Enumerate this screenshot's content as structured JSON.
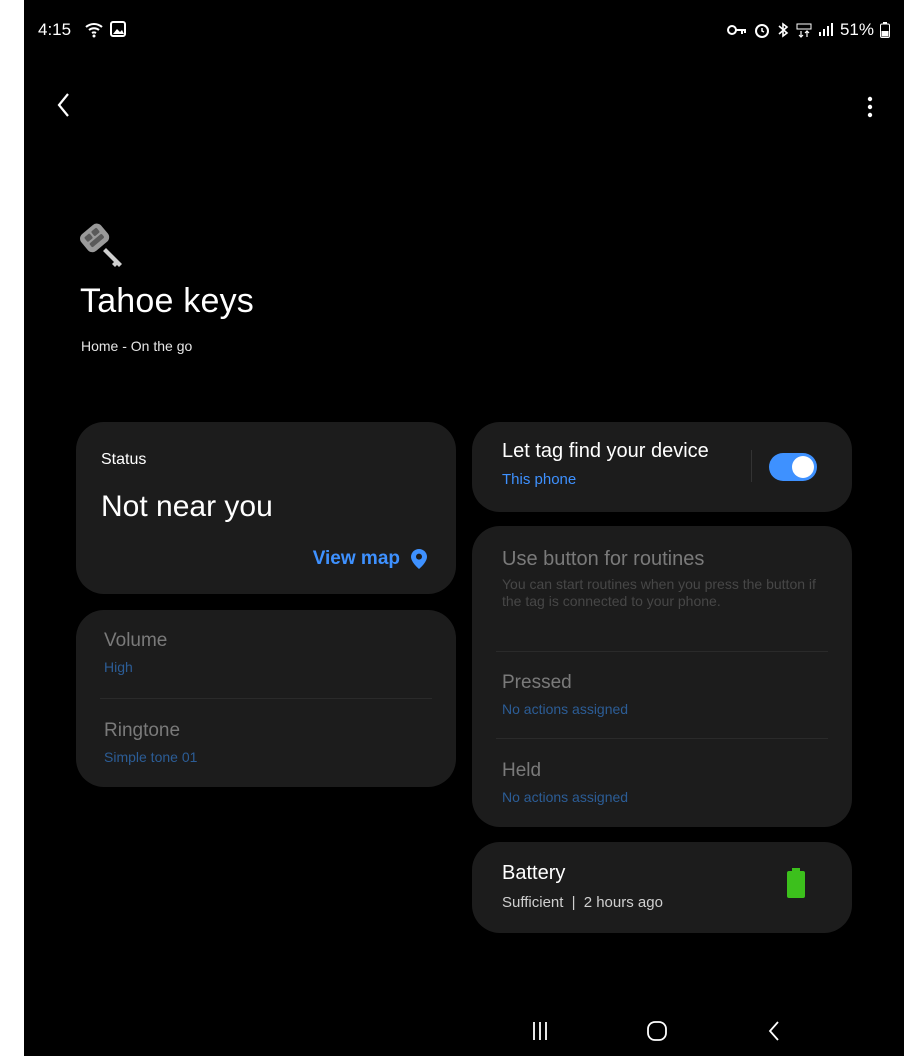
{
  "status_bar": {
    "time": "4:15",
    "battery_percent": "51%"
  },
  "header": {
    "title": "Tahoe keys",
    "subtitle": "Home - On the go"
  },
  "status_card": {
    "label": "Status",
    "value": "Not near you",
    "view_map_label": "View map"
  },
  "sound_card": {
    "volume_title": "Volume",
    "volume_value": "High",
    "ringtone_title": "Ringtone",
    "ringtone_value": "Simple tone 01"
  },
  "find_card": {
    "title": "Let tag find your device",
    "subtitle": "This phone",
    "toggle_on": true
  },
  "routines_card": {
    "title": "Use button for routines",
    "description": "You can start routines when you press the button if the tag is connected to your phone.",
    "pressed_title": "Pressed",
    "pressed_value": "No actions assigned",
    "held_title": "Held",
    "held_value": "No actions assigned"
  },
  "battery_card": {
    "title": "Battery",
    "status": "Sufficient",
    "separator": "|",
    "updated": "2 hours ago"
  },
  "colors": {
    "accent": "#3e91ff",
    "card_bg": "#1c1c1c",
    "battery_green": "#3cc01c"
  }
}
